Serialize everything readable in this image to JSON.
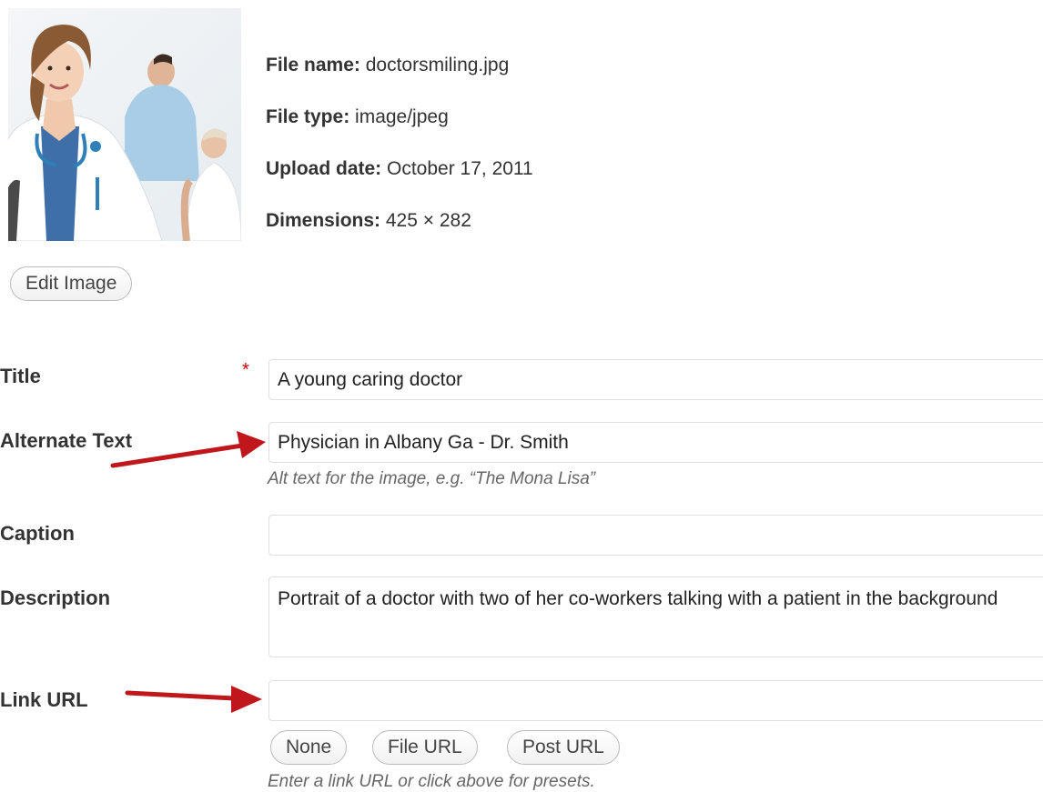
{
  "attachment": {
    "thumbnail_alt": "doctorsmiling.jpg",
    "file_name_label": "File name:",
    "file_name": "doctorsmiling.jpg",
    "file_type_label": "File type:",
    "file_type": "image/jpeg",
    "upload_date_label": "Upload date:",
    "upload_date": "October 17, 2011",
    "dimensions_label": "Dimensions:",
    "dimensions": "425 × 282",
    "edit_image_label": "Edit Image"
  },
  "form": {
    "title_label": "Title",
    "required_mark": "*",
    "title_value": "A young caring doctor",
    "alt_label": "Alternate Text",
    "alt_value": "Physician in Albany Ga - Dr. Smith",
    "alt_help": "Alt text for the image, e.g. “The Mona Lisa”",
    "caption_label": "Caption",
    "caption_value": "",
    "description_label": "Description",
    "description_value": "Portrait of a doctor with two of her co-workers talking with a patient in the background",
    "link_url_label": "Link URL",
    "link_url_value": "",
    "link_buttons": {
      "none": "None",
      "file_url": "File URL",
      "post_url": "Post URL"
    },
    "link_help": "Enter a link URL or click above for presets."
  },
  "annotations": {
    "arrow_color": "#c0171c"
  },
  "colors": {
    "required": "#cc0000",
    "field_border": "#dfdfdf",
    "label_text": "#333333",
    "help_text": "#666666"
  }
}
